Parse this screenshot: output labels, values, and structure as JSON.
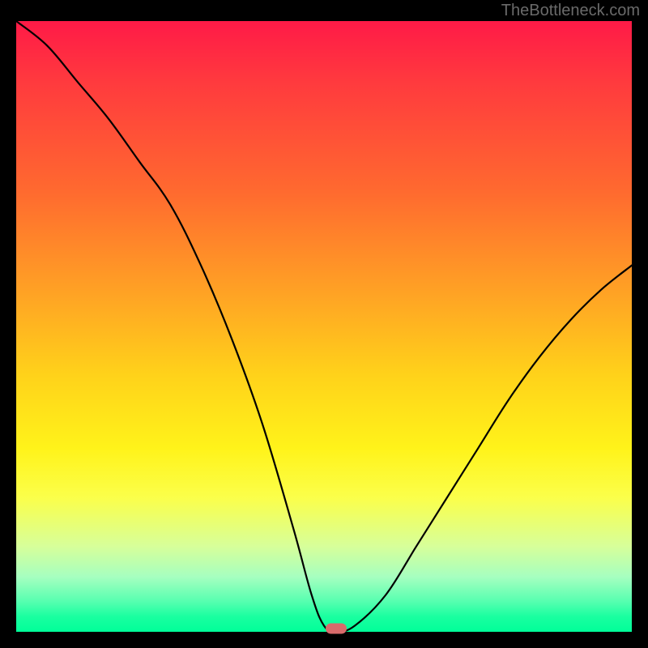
{
  "attribution": "TheBottleneck.com",
  "chart_data": {
    "type": "line",
    "title": "",
    "xlabel": "",
    "ylabel": "",
    "xlim": [
      0,
      100
    ],
    "ylim": [
      0,
      100
    ],
    "background_gradient": {
      "top": "#ff1a47",
      "bottom": "#00ff99",
      "kind": "vertical-red-to-green"
    },
    "series": [
      {
        "name": "bottleneck-curve",
        "description": "V-shaped black curve, value ≈ 0 near x≈52, rising toward 100 at the left edge and ≈60 at the right edge",
        "x": [
          0,
          5,
          10,
          15,
          20,
          25,
          30,
          35,
          40,
          45,
          48,
          50,
          52,
          55,
          60,
          65,
          70,
          75,
          80,
          85,
          90,
          95,
          100
        ],
        "values": [
          100,
          96,
          90,
          84,
          77,
          70,
          60,
          48,
          34,
          17,
          6,
          1,
          0,
          1,
          6,
          14,
          22,
          30,
          38,
          45,
          51,
          56,
          60
        ]
      }
    ],
    "marker": {
      "name": "optimal-point",
      "x": 52,
      "y": 0,
      "color": "#d86b6b"
    }
  }
}
